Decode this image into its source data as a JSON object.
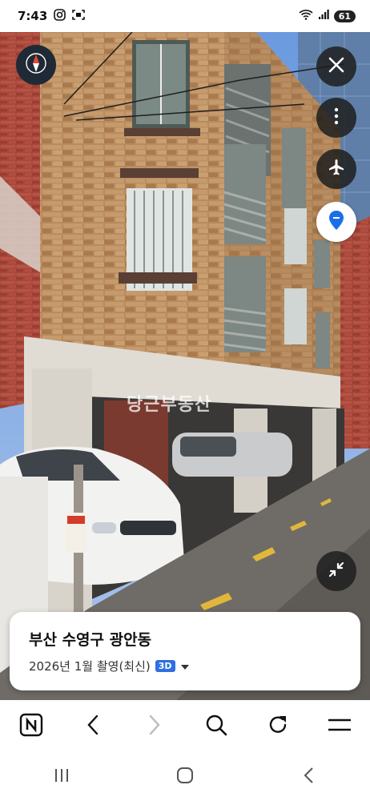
{
  "status_bar": {
    "time": "7:43",
    "battery": "61"
  },
  "watermark": "당근부동산",
  "location": {
    "title": "부산 수영구 광안동",
    "subtitle": "2026년 1월 촬영(최신)",
    "badge": "3D"
  },
  "icons": {
    "close": "close-icon",
    "more": "more-vertical-icon",
    "flight": "airplane-icon",
    "pin": "location-pin-icon",
    "shrink": "minimize-icon",
    "compass": "compass-icon",
    "n_logo": "naver-n-icon",
    "back": "chevron-left-icon",
    "forward": "chevron-right-icon",
    "search": "search-icon",
    "reload": "reload-icon",
    "menu": "hamburger-menu-icon"
  },
  "colors": {
    "accent": "#2f6fe0",
    "pin": "#1a6fe8",
    "fab_bg": "#1e1e1e"
  }
}
